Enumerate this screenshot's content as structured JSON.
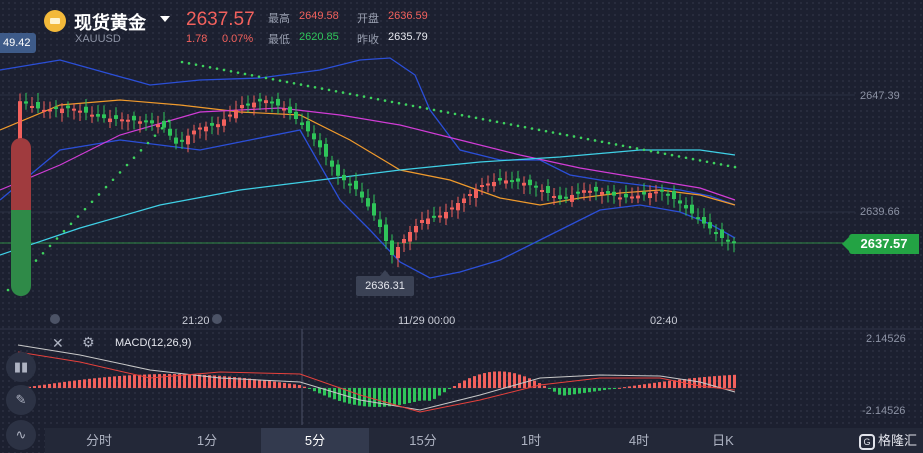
{
  "header": {
    "name": "现货黄金",
    "symbol": "XAUUSD",
    "last_price": "2637.57",
    "change_abs": "1.78",
    "change_pct": "0.07%",
    "high_label": "最高",
    "high_value": "2649.58",
    "low_label": "最低",
    "low_value": "2620.85",
    "open_label": "开盘",
    "open_value": "2636.59",
    "prev_close_label": "昨收",
    "prev_close_value": "2635.79"
  },
  "main_chart": {
    "last_price_tag": "2637.57",
    "prev_high_badge": "49.42",
    "low_marker": "2636.31",
    "y_labels": [
      "2647.39",
      "2639.66"
    ],
    "time_labels": [
      "21:20",
      "11/29 00:00",
      "02:40"
    ]
  },
  "sub_chart": {
    "indicator_label": "MACD(12,26,9)",
    "y_top": "2.14526",
    "y_bottom": "-2.14526"
  },
  "timeframes": [
    "分时",
    "1分",
    "5分",
    "15分",
    "1时",
    "4时",
    "日K"
  ],
  "active_timeframe": "5分",
  "brand": "格隆汇",
  "colors": {
    "up": "#f2615d",
    "down": "#2fc55a",
    "price_tag": "#23a344",
    "boll": "#2b4fd8",
    "ma_orange": "#f09a2c",
    "ma_magenta": "#d13cd6",
    "ma_cyan": "#3fd0e6"
  },
  "icons": [
    "gold-coin-icon",
    "chevron-down-icon",
    "close-icon",
    "settings-icon",
    "candles-icon",
    "pencil-icon",
    "indicator-icon"
  ]
}
